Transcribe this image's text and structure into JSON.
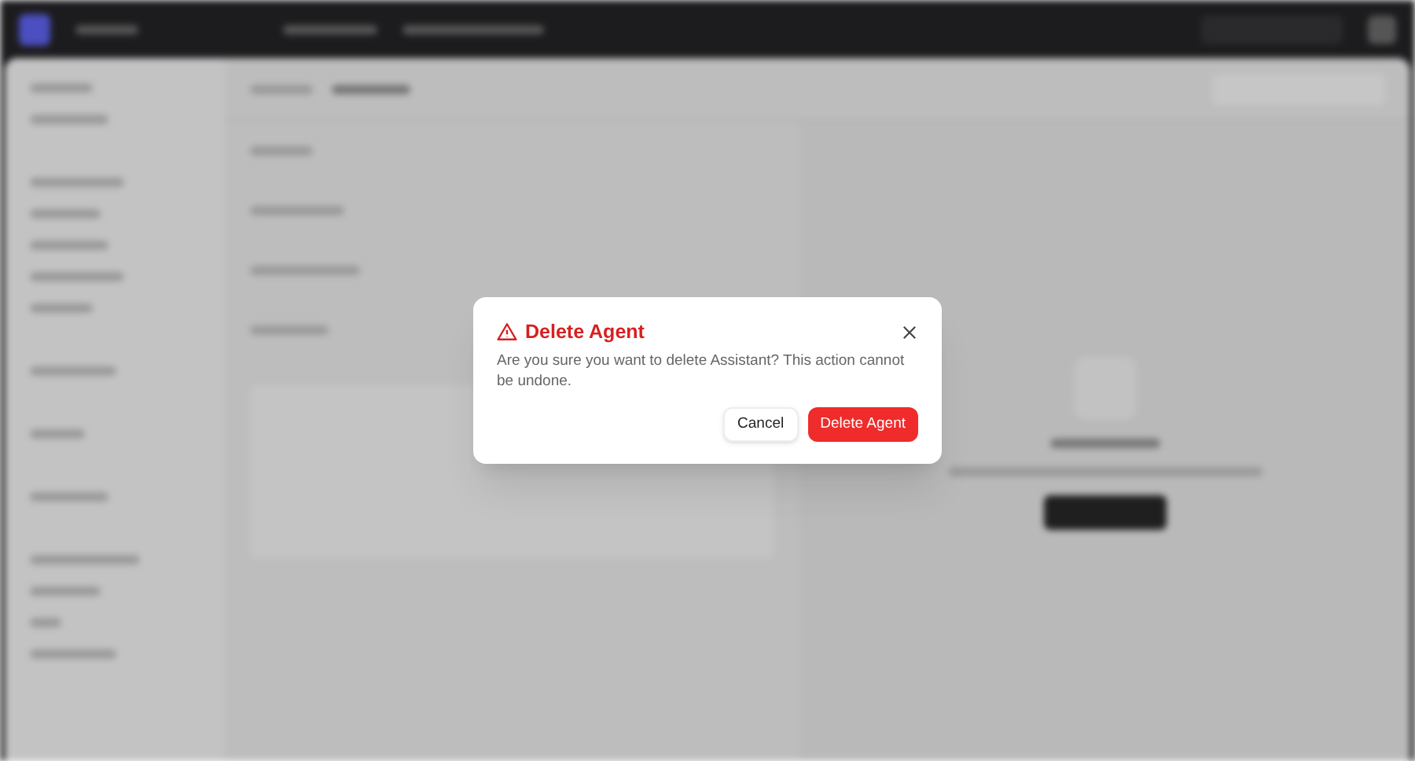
{
  "dialog": {
    "title": "Delete Agent",
    "message": "Are you sure you want to delete Assistant? This action cannot be undone.",
    "buttons": [
      {
        "label": "Cancel",
        "kind": "secondary"
      },
      {
        "label": "Delete Agent",
        "kind": "danger"
      }
    ]
  }
}
